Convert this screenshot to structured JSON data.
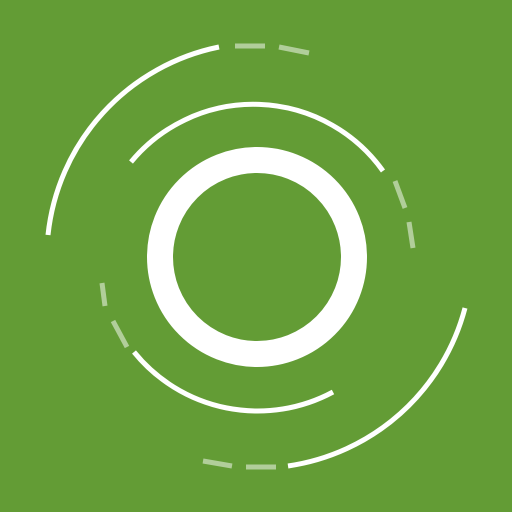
{
  "icon": {
    "name": "concentric-rings-logo",
    "colors": {
      "background": "#639c35",
      "foreground": "#ffffff"
    }
  }
}
